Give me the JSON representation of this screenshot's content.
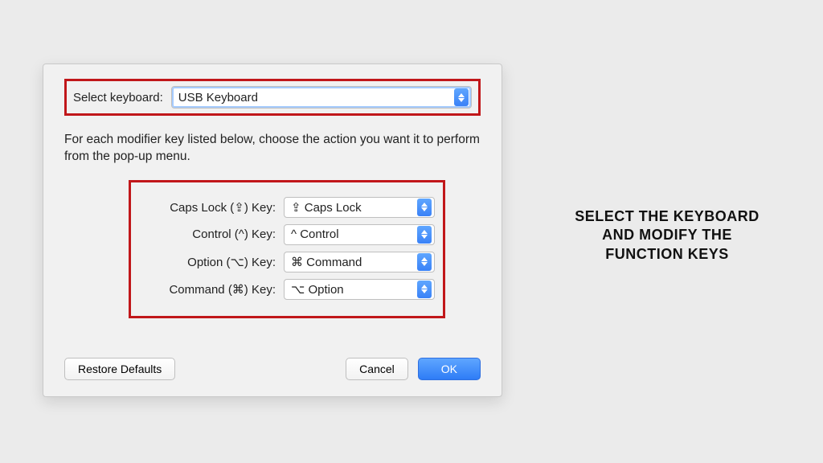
{
  "keyboardSelect": {
    "label": "Select keyboard:",
    "value": "USB Keyboard"
  },
  "instructions": "For each modifier key listed below, choose the action you want it to perform from the pop-up menu.",
  "modifiers": [
    {
      "label": "Caps Lock (⇪) Key:",
      "value": "⇪ Caps Lock"
    },
    {
      "label": "Control (^) Key:",
      "value": "^ Control"
    },
    {
      "label": "Option (⌥) Key:",
      "value": "⌘ Command"
    },
    {
      "label": "Command (⌘) Key:",
      "value": "⌥ Option"
    }
  ],
  "buttons": {
    "restore": "Restore Defaults",
    "cancel": "Cancel",
    "ok": "OK"
  },
  "annotation": "SELECT THE KEYBOARD AND MODIFY THE FUNCTION KEYS"
}
